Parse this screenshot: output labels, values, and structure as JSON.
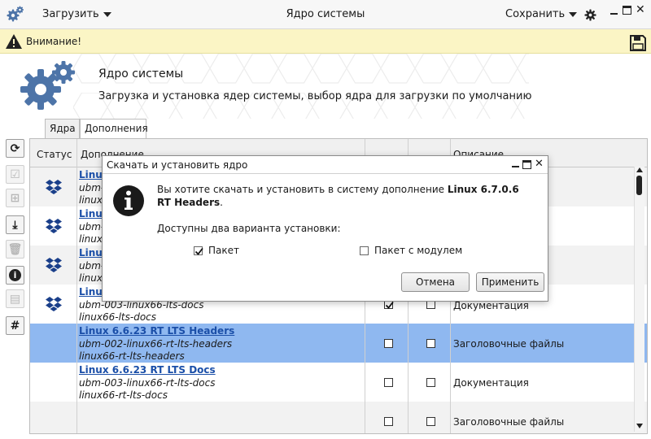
{
  "window": {
    "title": "Ядро системы",
    "load_label": "Загрузить",
    "save_label": "Сохранить"
  },
  "warning": {
    "text": "Внимание!"
  },
  "header": {
    "title": "Ядро системы",
    "subtitle": "Загрузка и установка ядер системы, выбор ядра для загрузки по умолчанию"
  },
  "tabs": [
    {
      "label": "Ядра"
    },
    {
      "label": "Дополнения"
    }
  ],
  "table": {
    "headers": [
      "Статус",
      "Дополнение",
      "",
      "",
      "Описание"
    ],
    "rows": [
      {
        "title": "Linux",
        "line1": "ubm-",
        "line2": "linux",
        "status_icon": "dropbox-icon",
        "check1": false,
        "check2": false,
        "desc": ""
      },
      {
        "title": "Linux",
        "line1": "ubm-",
        "line2": "linux",
        "status_icon": "dropbox-icon",
        "check1": false,
        "check2": false,
        "desc": ""
      },
      {
        "title": "Linux",
        "line1": "ubm-",
        "line2": "linux",
        "status_icon": "dropbox-icon",
        "check1": false,
        "check2": false,
        "desc": ""
      },
      {
        "title": "Linux",
        "line1": "ubm-003-linux66-lts-docs",
        "line2": "linux66-lts-docs",
        "status_icon": "dropbox-icon",
        "check1": true,
        "check2": false,
        "desc": "Документация"
      },
      {
        "title": "Linux 6.6.23 RT LTS Headers",
        "line1": "ubm-002-linux66-rt-lts-headers",
        "line2": "linux66-rt-lts-headers",
        "status_icon": "",
        "check1": false,
        "check2": false,
        "desc": "Заголовочные файлы"
      },
      {
        "title": "Linux 6.6.23 RT LTS Docs",
        "line1": "ubm-003-linux66-rt-lts-docs",
        "line2": "linux66-rt-lts-docs",
        "status_icon": "",
        "check1": false,
        "check2": false,
        "desc": "Документация"
      },
      {
        "title": "",
        "line1": "",
        "line2": "",
        "status_icon": "",
        "check1": false,
        "check2": false,
        "desc": "Заголовочные файлы"
      }
    ]
  },
  "dialog": {
    "title": "Скачать и установить ядро",
    "message_prefix": "Вы хотите скачать и установить в систему дополнение ",
    "message_bold": "Linux 6.7.0.6 RT Headers",
    "message_suffix": ".",
    "options_label": "Доступны два варианта установки:",
    "option_package": "Пакет",
    "option_package_checked": true,
    "option_module": "Пакет с модулем",
    "option_module_checked": false,
    "cancel_label": "Отмена",
    "apply_label": "Применить"
  },
  "colors": {
    "accent_blue": "#4d74a8",
    "selected_row": "#8fb8f0",
    "warning_bg": "#fbf5c5",
    "link": "#1b4fa8"
  }
}
